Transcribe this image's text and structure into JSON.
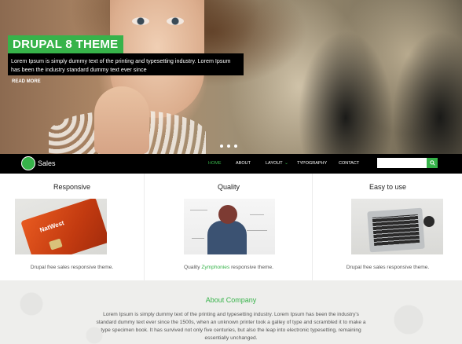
{
  "hero": {
    "title": "DRUPAL 8 THEME",
    "text": "Lorem Ipsum is simply dummy text of the printing and typesetting industry. Lorem Ipsum has been the industry standard dummy text ever since",
    "read_more": "READ MORE",
    "slides": 3
  },
  "nav": {
    "logo_text": "Sales",
    "items": [
      "HOME",
      "ABOUT",
      "LAYOUT",
      "TYPOGRAPHY",
      "CONTACT"
    ],
    "active": "HOME",
    "search_placeholder": ""
  },
  "features": [
    {
      "title": "Responsive",
      "caption": "Drupal free sales responsive theme."
    },
    {
      "title": "Quality",
      "caption_pre": "Quality ",
      "caption_link": "Zymphonies",
      "caption_post": " responsive theme."
    },
    {
      "title": "Easy to use",
      "caption": "Drupal free sales responsive theme."
    }
  ],
  "card": {
    "brand": "NatWest"
  },
  "about": {
    "title": "About Company",
    "text": "Lorem Ipsum is simply dummy text of the printing and typesetting industry. Lorem Ipsum has been the industry's standard dummy text ever since the 1500s, when an unknown printer took a galley of type and scrambled it to make a type specimen book. It has survived not only five centuries, but also the leap into electronic typesetting, remaining essentially unchanged."
  },
  "colors": {
    "accent": "#37b34a",
    "nav_bg": "#000000"
  },
  "icons": {
    "search": "search-icon",
    "logo": "logo-circle-icon",
    "chevron": "chevron-down-icon"
  }
}
